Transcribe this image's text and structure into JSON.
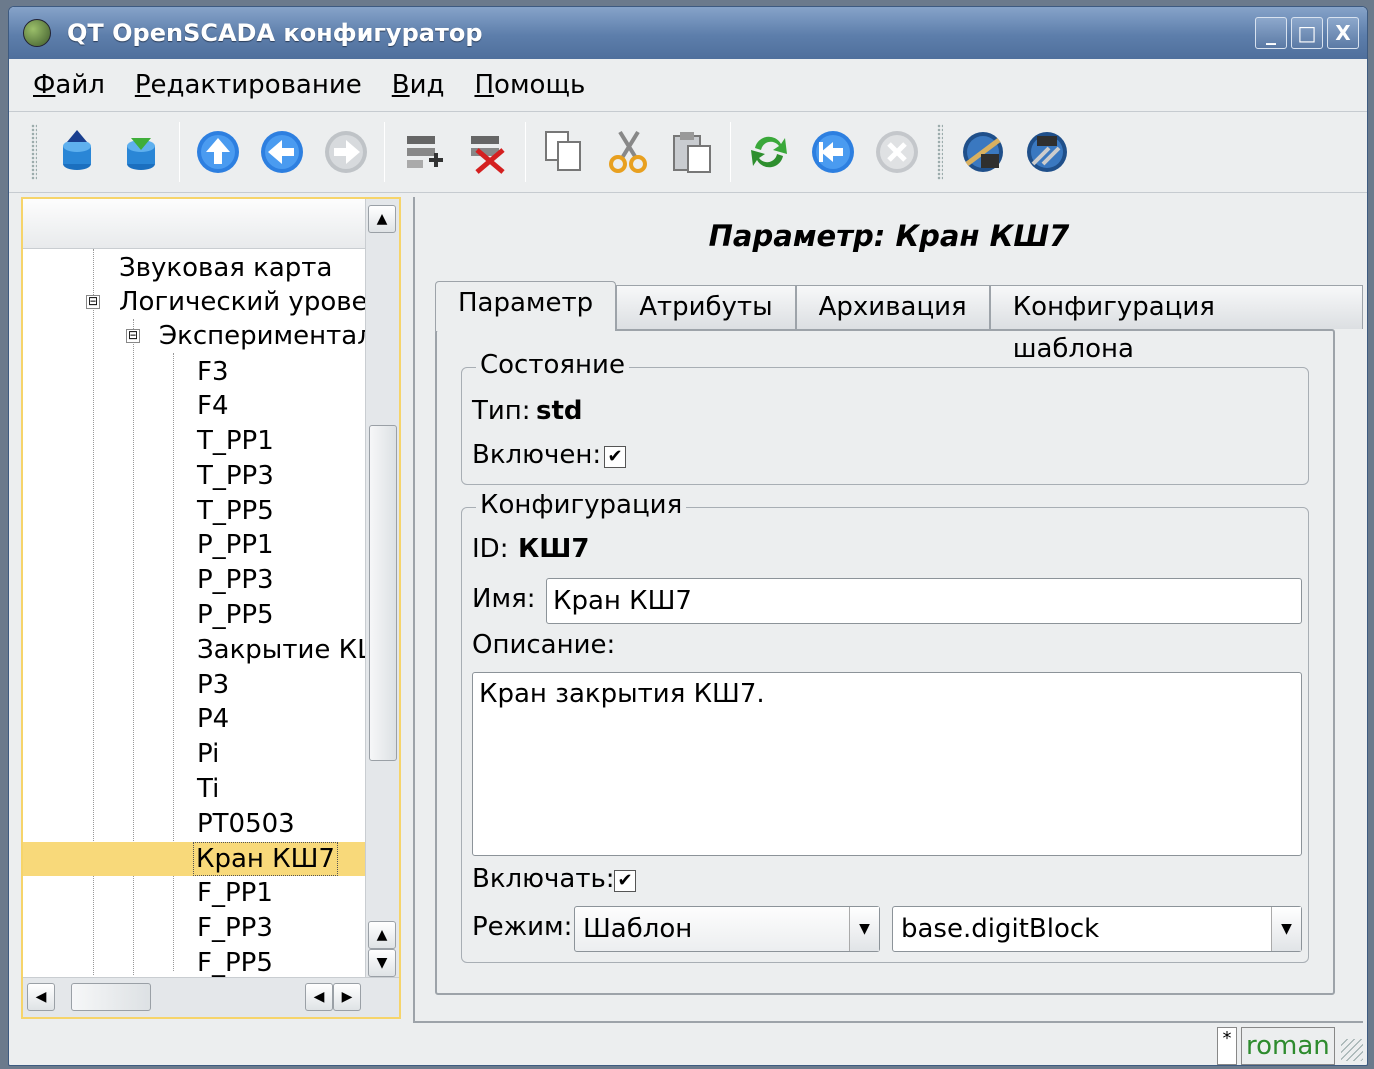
{
  "window": {
    "title": "QT OpenSCADA конфигуратор",
    "minimize": "_",
    "maximize": "□",
    "close": "X"
  },
  "menu": [
    "Файл",
    "Редактирование",
    "Вид",
    "Помощь"
  ],
  "tree": {
    "items": [
      {
        "label": "Звуковая карта"
      },
      {
        "label": "Логический уровень"
      },
      {
        "label": "Экспериментальн"
      },
      {
        "label": "F3"
      },
      {
        "label": "F4"
      },
      {
        "label": "T_PP1"
      },
      {
        "label": "T_PP3"
      },
      {
        "label": "T_PP5"
      },
      {
        "label": "P_PP1"
      },
      {
        "label": "P_PP3"
      },
      {
        "label": "P_PP5"
      },
      {
        "label": "Закрытие КШ"
      },
      {
        "label": "P3"
      },
      {
        "label": "P4"
      },
      {
        "label": "Pi"
      },
      {
        "label": "Ti"
      },
      {
        "label": "PT0503"
      },
      {
        "label": "Кран КШ7"
      },
      {
        "label": "F_PP1"
      },
      {
        "label": "F_PP3"
      },
      {
        "label": "F_PP5"
      }
    ],
    "expander_open": "⊟"
  },
  "page": {
    "heading": "Параметр: Кран КШ7"
  },
  "tabs": [
    "Параметр",
    "Атрибуты",
    "Архивация",
    "Конфигурация шаблона"
  ],
  "state": {
    "legend": "Состояние",
    "type_label": "Тип:",
    "type_value": "std",
    "enabled_label": "Включен:",
    "enabled_check": "✔"
  },
  "config": {
    "legend": "Конфигурация",
    "id_label": "ID:",
    "id_value": "КШ7",
    "name_label": "Имя:",
    "name_value": "Кран КШ7",
    "descr_label": "Описание:",
    "descr_value": "Кран закрытия КШ7.",
    "enable_label": "Включать:",
    "enable_check": "✔",
    "mode_label": "Режим:",
    "mode_value": "Шаблон",
    "template_value": "base.digitBlock"
  },
  "status": {
    "modified": "*",
    "user": "roman"
  },
  "colors": {
    "selection": "#f8d97a",
    "title_bar": "#5d7eab",
    "user_text": "#2e8b2e"
  }
}
